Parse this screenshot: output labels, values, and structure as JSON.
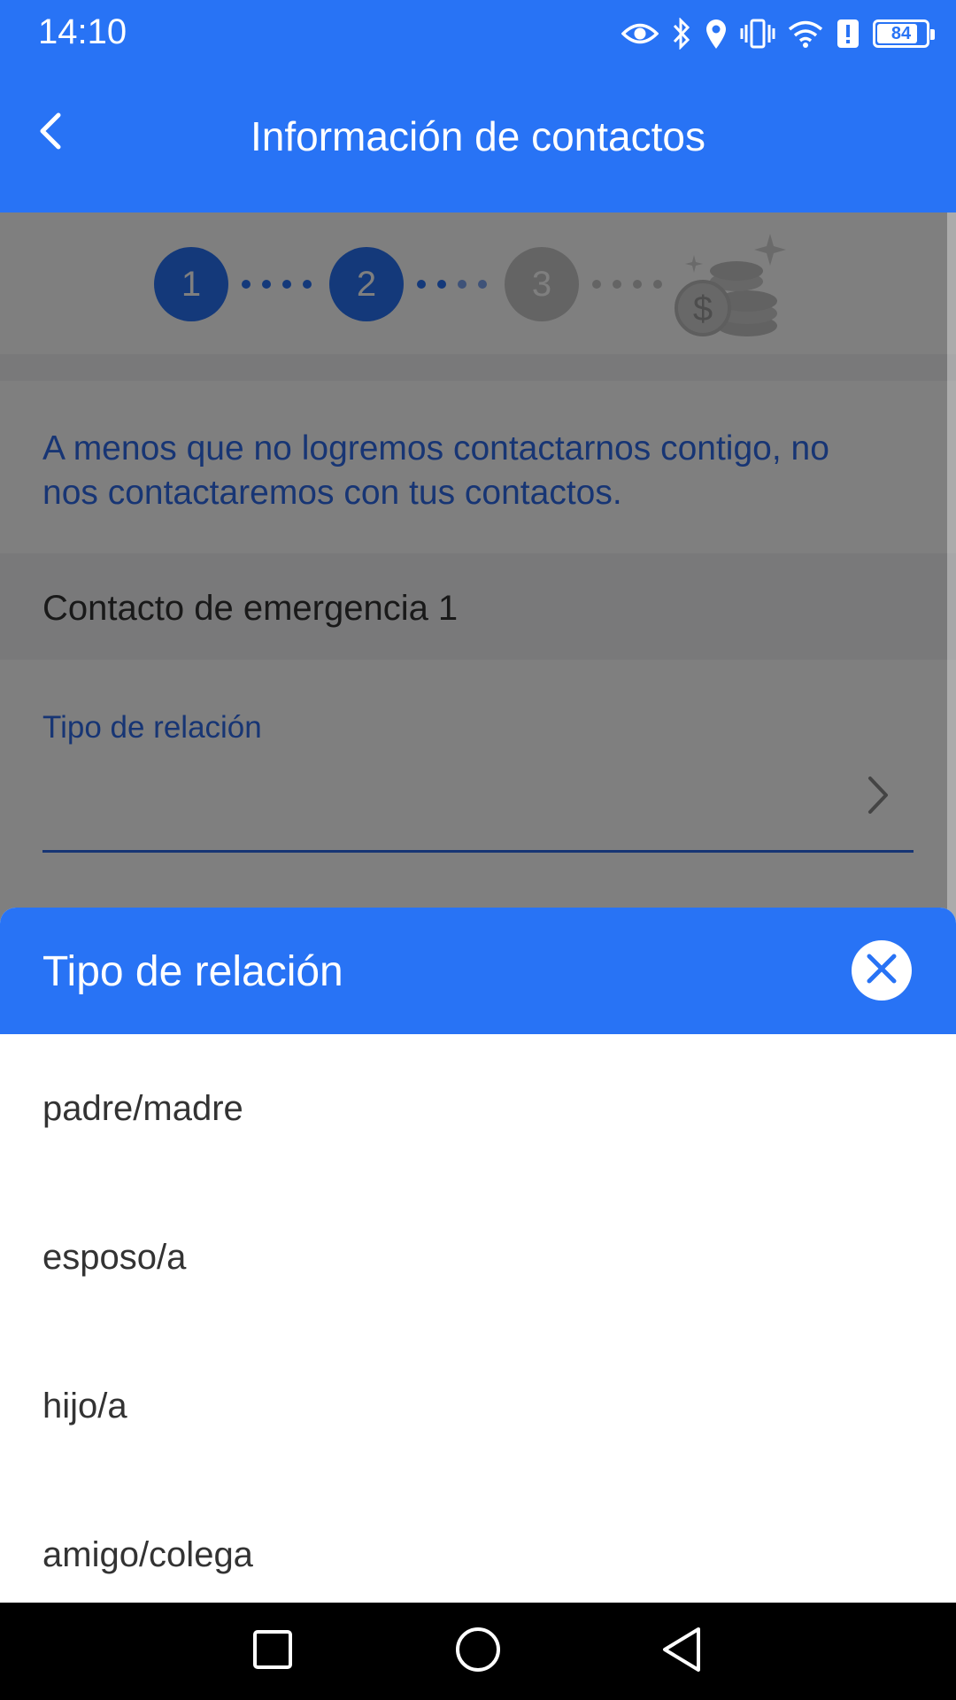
{
  "status_bar": {
    "time": "14:10",
    "battery": "84",
    "battery_level": 0.84,
    "icons": [
      "eye-icon",
      "bluetooth-icon",
      "location-icon",
      "vibrate-icon",
      "wifi-icon",
      "alert-icon",
      "battery-icon"
    ]
  },
  "app_bar": {
    "title": "Información de contactos",
    "back_icon": "chevron-left-icon"
  },
  "steps": {
    "items": [
      {
        "label": "1",
        "state": "done"
      },
      {
        "label": "2",
        "state": "active"
      },
      {
        "label": "3",
        "state": "pending"
      }
    ],
    "final_icon": "coins-icon"
  },
  "notice": {
    "text": "A menos que no logremos contactarnos contigo, no nos contactaremos con tus contactos."
  },
  "section": {
    "title": "Contacto de emergencia 1"
  },
  "field": {
    "label": "Tipo de relación",
    "value": ""
  },
  "sheet": {
    "title": "Tipo de relación",
    "options": [
      {
        "label": "padre/madre"
      },
      {
        "label": "esposo/a"
      },
      {
        "label": "hijo/a"
      },
      {
        "label": "amigo/colega"
      }
    ]
  },
  "colors": {
    "primary": "#2873f5",
    "accent_text": "#2f6ae8",
    "step_pending": "#c8c8c8"
  }
}
